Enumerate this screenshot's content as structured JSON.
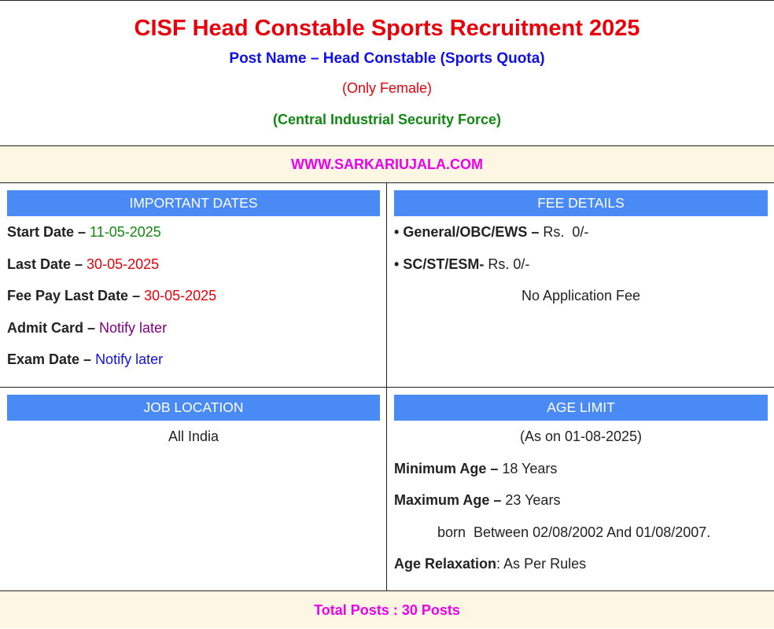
{
  "header": {
    "title": "CISF Head Constable Sports Recruitment 2025",
    "post_name": "Post Name – Head Constable (Sports Quota)",
    "gender_note": "(Only Female)",
    "organization": "(Central Industrial Security Force)"
  },
  "website": "WWW.SARKARIUJALA.COM",
  "important_dates": {
    "heading": "IMPORTANT DATES",
    "items": [
      {
        "label": "Start Date – ",
        "value": "11-05-2025",
        "color": "#118811"
      },
      {
        "label": "Last Date – ",
        "value": "30-05-2025",
        "color": "#e8000b"
      },
      {
        "label": "Fee Pay Last Date – ",
        "value": "30-05-2025",
        "color": "#e8000b"
      },
      {
        "label": "Admit Card – ",
        "value": "Notify later",
        "color": "#800080"
      },
      {
        "label": "Exam Date – ",
        "value": "Notify later",
        "color": "#1010e8"
      }
    ]
  },
  "fee_details": {
    "heading": "FEE DETAILS",
    "items": [
      {
        "bullet": "• ",
        "label": "General/OBC/EWS – ",
        "value": "Rs.  0/-"
      },
      {
        "bullet": "• ",
        "label": "SC/ST/ESM- ",
        "value": "Rs. 0/-"
      }
    ],
    "note": "No Application Fee"
  },
  "job_location": {
    "heading": "JOB LOCATION",
    "value": "All India"
  },
  "age_limit": {
    "heading": "AGE LIMIT",
    "as_on": "(As on 01-08-2025)",
    "min_label": "Minimum Age – ",
    "min_value": "18 Years",
    "max_label": "Maximum Age – ",
    "max_value": "23 Years",
    "born_between": "born  Between 02/08/2002 And 01/08/2007.",
    "relax_label": "Age Relaxation",
    "relax_value": ": As Per Rules"
  },
  "total_posts": "Total Posts : 30 Posts",
  "colors": {
    "title": "#e8000b",
    "post": "#1010e8",
    "organization": "#118811",
    "website": "#ee00ee",
    "cell_header": "#4a8af4",
    "band_bg": "#fcf6e2"
  }
}
